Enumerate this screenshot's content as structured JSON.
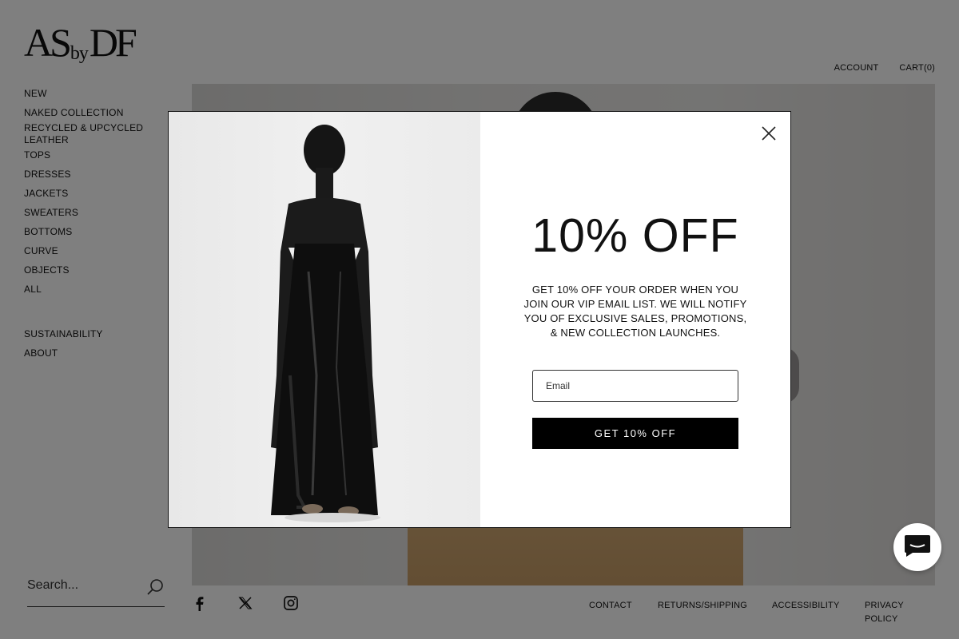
{
  "brand": {
    "logo_part1": "AS",
    "logo_part2": "by",
    "logo_part3": "DF"
  },
  "top_nav": {
    "account": "ACCOUNT",
    "cart": "CART(0)"
  },
  "side_nav": {
    "primary": [
      "NEW",
      "NAKED COLLECTION",
      "RECYCLED & UPCYCLED LEATHER",
      "TOPS",
      "DRESSES",
      "JACKETS",
      "SWEATERS",
      "BOTTOMS",
      "CURVE",
      "OBJECTS",
      "ALL"
    ],
    "secondary": [
      "SUSTAINABILITY",
      "ABOUT"
    ]
  },
  "search": {
    "placeholder": "Search..."
  },
  "social": [
    "facebook-icon",
    "x-icon",
    "instagram-icon"
  ],
  "footer": {
    "contact": "CONTACT",
    "returns": "RETURNS/SHIPPING",
    "accessibility": "ACCESSIBILITY",
    "privacy": "PRIVACY POLICY"
  },
  "popup": {
    "headline": "10% OFF",
    "description": "GET 10% OFF YOUR ORDER WHEN YOU JOIN OUR VIP EMAIL LIST. WE WILL NOTIFY YOU OF EXCLUSIVE SALES, PROMOTIONS, & NEW COLLECTION LAUNCHES.",
    "email_placeholder": "Email",
    "cta_label": "GET 10% OFF"
  },
  "colors": {
    "overlay": "#000000",
    "cta_bg": "#000000",
    "cta_text": "#ffffff",
    "chat_icon": "#000000"
  }
}
